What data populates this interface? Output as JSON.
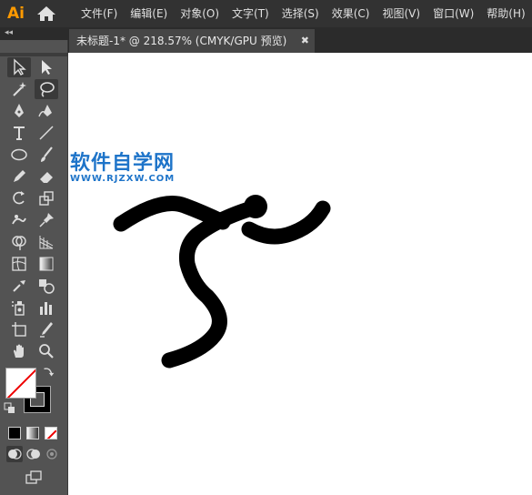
{
  "app": {
    "logo": "Ai"
  },
  "menu": [
    "文件(F)",
    "编辑(E)",
    "对象(O)",
    "文字(T)",
    "选择(S)",
    "效果(C)",
    "视图(V)",
    "窗口(W)",
    "帮助(H)"
  ],
  "document_tab": {
    "title": "未标题-1* @ 218.57% (CMYK/GPU 预览)",
    "close": "✖"
  },
  "panel_collapse": "◂◂",
  "watermark": {
    "title": "软件自学网",
    "url": "WWW.RJZXW.COM"
  },
  "colors": {
    "menubar": "#323232",
    "canvas": "#ffffff",
    "watermark": "#1e74c9",
    "logo": "#ff9a00"
  },
  "tools": [
    "selection-tool",
    "direct-selection-tool",
    "magic-wand-tool",
    "lasso-tool",
    "pen-tool",
    "curvature-tool",
    "type-tool",
    "line-tool",
    "ellipse-tool",
    "paintbrush-tool",
    "pencil-tool",
    "eraser-tool",
    "rotate-tool",
    "scale-tool",
    "puppet-warp-tool",
    "pin-tool",
    "shape-builder-tool",
    "perspective-grid-tool",
    "mesh-tool",
    "gradient-tool",
    "eyedropper-tool",
    "blend-tool",
    "symbol-sprayer-tool",
    "column-graph-tool",
    "artboard-tool",
    "slice-tool",
    "hand-tool",
    "zoom-tool"
  ]
}
